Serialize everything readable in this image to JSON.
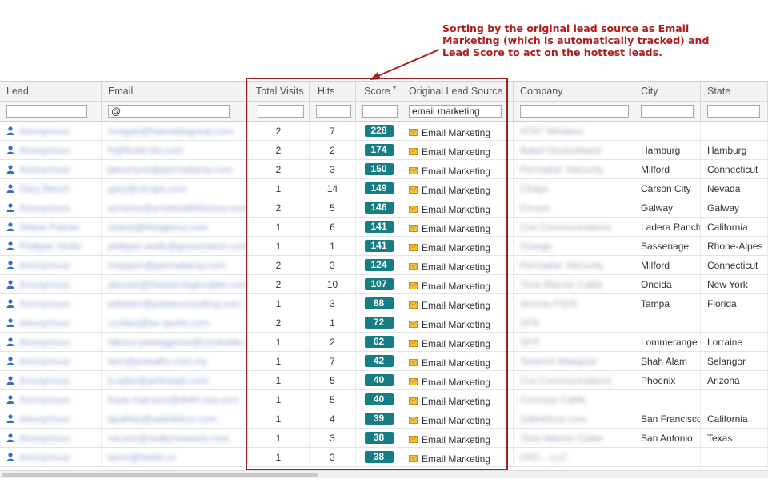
{
  "callout": {
    "line1": "Sorting by the original lead source as Email",
    "line2": "Marketing (which is automatically tracked) and",
    "line3": "Lead Score to act on the hottest leads."
  },
  "columns": {
    "lead": "Lead",
    "email": "Email",
    "total_visits": "Total Visits",
    "hits": "Hits",
    "score": "Score",
    "original_lead_source": "Original Lead Source",
    "company": "Company",
    "city": "City",
    "state": "State"
  },
  "filters": {
    "email": "@",
    "source": "email marketing"
  },
  "icons": {
    "lead": "person-icon",
    "source": "envelope-icon",
    "sort": "sort-desc-icon"
  },
  "colors": {
    "score_badge": "#167d83",
    "callout": "#b01c1c",
    "hits_link": "#2a5db0"
  },
  "rows": [
    {
      "lead": "Anonymous",
      "email": "mregan@harmattagroup.com",
      "visits": "2",
      "hits": "7",
      "score": "228",
      "source": "Email Marketing",
      "company": "AT&T Wireless",
      "city": "",
      "state": ""
    },
    {
      "lead": "Anonymous",
      "email": "fr@flexbt-bln.com",
      "visits": "2",
      "hits": "2",
      "score": "174",
      "source": "Email Marketing",
      "company": "Babel Deutschland",
      "city": "Hamburg",
      "state": "Hamburg"
    },
    {
      "lead": "Anonymous",
      "email": "jdevenyns@permattaray.com",
      "visits": "2",
      "hits": "3",
      "score": "150",
      "source": "Email Marketing",
      "company": "Permattar Jdecurity",
      "city": "Milford",
      "state": "Connecticut"
    },
    {
      "lead": "Gary Beech",
      "email": "gary@cfrraps.com",
      "visits": "1",
      "hits": "14",
      "score": "149",
      "source": "Email Marketing",
      "company": "Cfraps",
      "city": "Carson City",
      "state": "Nevada"
    },
    {
      "lead": "Anonymous",
      "email": "armemo@yrnebealthfactory.com",
      "visits": "2",
      "hits": "5",
      "score": "146",
      "source": "Email Marketing",
      "company": "Eircom",
      "city": "Galway",
      "state": "Galway"
    },
    {
      "lead": "Shane Palmer",
      "email": "shane@theagency.com",
      "visits": "1",
      "hits": "6",
      "score": "141",
      "source": "Email Marketing",
      "company": "Cox Communications",
      "city": "Ladera Ranch",
      "state": "California"
    },
    {
      "lead": "Philippe Vieille",
      "email": "philippe.vieille@gocemation.com",
      "visits": "1",
      "hits": "1",
      "score": "141",
      "source": "Email Marketing",
      "company": "Orange",
      "city": "Sassenage",
      "state": "Rhone-Alpes"
    },
    {
      "lead": "Anonymous",
      "email": "mkippen@permattaray.com",
      "visits": "2",
      "hits": "3",
      "score": "124",
      "source": "Email Marketing",
      "company": "Permattar Jdecurity",
      "city": "Milford",
      "state": "Connecticut"
    },
    {
      "lead": "Anonymous",
      "email": "pbosse@thelearningenabler.com",
      "visits": "2",
      "hits": "10",
      "score": "107",
      "source": "Email Marketing",
      "company": "Time Warner Cable",
      "city": "Oneida",
      "state": "New York"
    },
    {
      "lead": "Anonymous",
      "email": "pdeleter@pdataconsulting.com",
      "visits": "1",
      "hits": "3",
      "score": "88",
      "source": "Email Marketing",
      "company": "Verizon FIOS",
      "city": "Tampa",
      "state": "Florida"
    },
    {
      "lead": "Anonymous",
      "email": "contact@ee-sports.com",
      "visits": "2",
      "hits": "1",
      "score": "72",
      "source": "Email Marketing",
      "company": "SFR",
      "city": "",
      "state": ""
    },
    {
      "lead": "Anonymous",
      "email": "fabrice.peletiggrene@comlobile.com",
      "visits": "1",
      "hits": "2",
      "score": "62",
      "source": "Email Marketing",
      "company": "SFR",
      "city": "Lommerange",
      "state": "Lorraine"
    },
    {
      "lead": "Anonymous",
      "email": "wim@pinhalfm.com.my",
      "visits": "1",
      "hits": "7",
      "score": "42",
      "source": "Email Marketing",
      "company": "Telekom Malaysia",
      "city": "Shah Alam",
      "state": "Selangor"
    },
    {
      "lead": "Anonymous",
      "email": "b.adler@arthreads.com",
      "visits": "1",
      "hits": "5",
      "score": "40",
      "source": "Email Marketing",
      "company": "Cox Communications",
      "city": "Phoenix",
      "state": "Arizona"
    },
    {
      "lead": "Anonymous",
      "email": "frank.marcano@delhi-usa.com",
      "visits": "1",
      "hits": "5",
      "score": "40",
      "source": "Email Marketing",
      "company": "Comcast Cable",
      "city": "",
      "state": ""
    },
    {
      "lead": "Anonymous",
      "email": "bpalhan@salesforce.com",
      "visits": "1",
      "hits": "4",
      "score": "39",
      "source": "Email Marketing",
      "company": "Salesforce.com",
      "city": "San Francisco",
      "state": "California"
    },
    {
      "lead": "Anonymous",
      "email": "rarcam@realtymeasure.com",
      "visits": "1",
      "hits": "3",
      "score": "38",
      "source": "Email Marketing",
      "company": "Time Warner Cable",
      "city": "San Antonio",
      "state": "Texas"
    },
    {
      "lead": "Anonymous",
      "email": "kevin@lionht.co",
      "visits": "1",
      "hits": "3",
      "score": "38",
      "source": "Email Marketing",
      "company": "ORC - LLC",
      "city": "",
      "state": ""
    }
  ]
}
